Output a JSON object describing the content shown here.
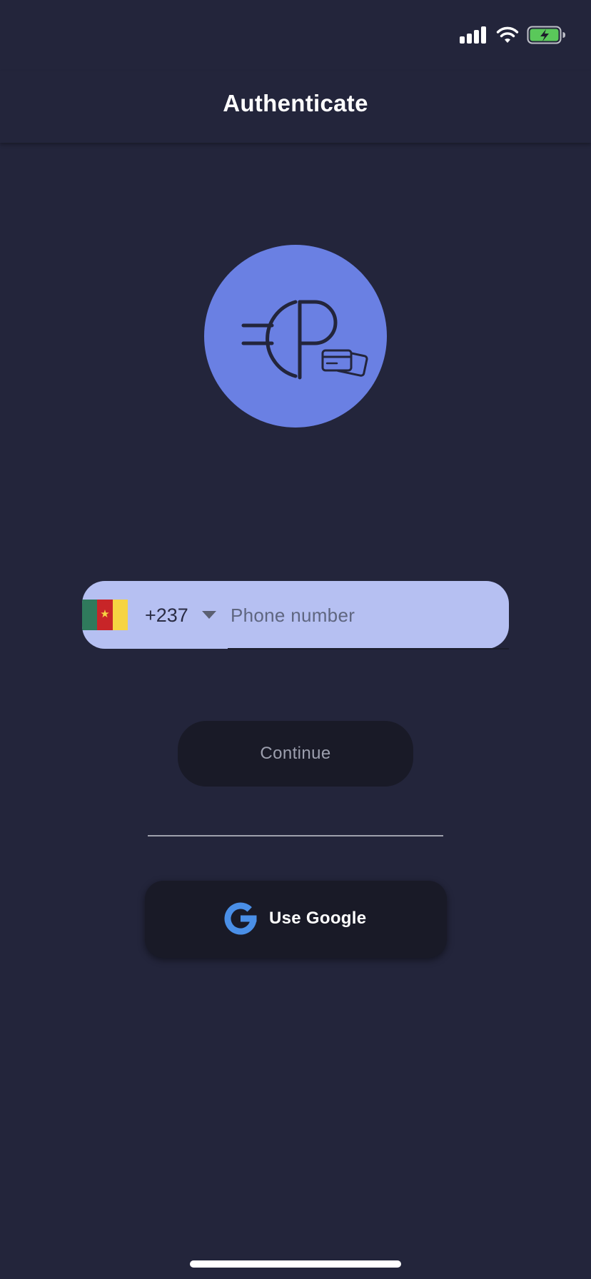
{
  "status_bar": {
    "icons": [
      "signal-icon",
      "wifi-icon",
      "battery-charging-icon"
    ],
    "battery_color": "#5ac85a"
  },
  "header": {
    "title": "Authenticate"
  },
  "logo": {
    "icon": "ep-card-logo-icon",
    "background_color": "#6a80e3"
  },
  "phone": {
    "country_flag": "cameroon-flag-icon",
    "dial_code": "+237",
    "dropdown_icon": "triangle-down-icon",
    "value": "",
    "placeholder": "Phone number",
    "field_color": "#b6c0f2"
  },
  "continue": {
    "label": "Continue"
  },
  "google": {
    "icon": "google-g-icon",
    "label": "Use Google",
    "icon_color": "#4a8fe7"
  },
  "colors": {
    "background": "#23253b",
    "button_dark": "#191a27"
  }
}
